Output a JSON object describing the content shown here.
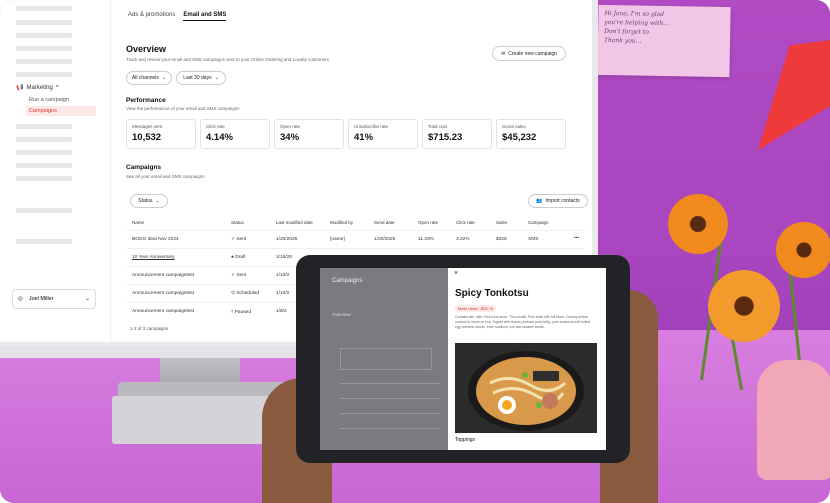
{
  "note_lines": [
    "Hi Jana, I'm so glad",
    "you're helping with...",
    "Don't forget to",
    "Thank you..."
  ],
  "sidebar": {
    "marketing": "Marketing",
    "run_campaign": "Run a campaign",
    "campaigns": "Campaigns",
    "user": "Joel Miller"
  },
  "tabs": [
    "Ads & promotions",
    "Email and SMS"
  ],
  "overview": {
    "title": "Overview",
    "subtitle": "Track and review your email and SMS campaigns sent to your Online Ordering and Loyalty customers",
    "create_button": "Create new campaign",
    "filter_channels": "All channels",
    "filter_days": "Last 30 days"
  },
  "performance": {
    "title": "Performance",
    "subtitle": "View the performance of your email and SMS campaigns",
    "cards": [
      {
        "label": "Messages sent",
        "value": "10,532"
      },
      {
        "label": "Click rate",
        "value": "4.14%"
      },
      {
        "label": "Open rate",
        "value": "34%"
      },
      {
        "label": "Unsubscribe rate",
        "value": "41%"
      },
      {
        "label": "Total cost",
        "value": "$715.23"
      },
      {
        "label": "Gross sales",
        "value": "$45,232"
      }
    ]
  },
  "campaigns": {
    "title": "Campaigns",
    "subtitle": "See all your email and SMS campaigns",
    "status_filter": "Status",
    "import_button": "Import contacts",
    "headers": [
      "Name",
      "Status",
      "Last modified date",
      "Modified by",
      "Send date",
      "Open rate",
      "Click rate",
      "Sales",
      "Campaign"
    ],
    "rows": [
      {
        "name": "BOGO deal Nov 2024",
        "status": "Sent",
        "modified": "1/20/2025",
        "by": "[name]",
        "send": "1/20/2025",
        "open": "11.33%",
        "click": "3.22%",
        "sales": "$326",
        "type": "SMS",
        "more": "•••"
      },
      {
        "name": "10 Year Anniversary",
        "status": "Draft",
        "modified": "1/16/20",
        "by": "",
        "send": "",
        "open": "",
        "click": "",
        "sales": "",
        "type": "",
        "more": ""
      },
      {
        "name": "Announcement campaigntest",
        "status": "Sent",
        "modified": "1/10/2",
        "by": "",
        "send": "",
        "open": "",
        "click": "",
        "sales": "",
        "type": "",
        "more": ""
      },
      {
        "name": "Announcement campaigntest",
        "status": "Scheduled",
        "modified": "1/10/2",
        "by": "",
        "send": "",
        "open": "",
        "click": "",
        "sales": "",
        "type": "",
        "more": ""
      },
      {
        "name": "Announcement campaigntest",
        "status": "Paused",
        "modified": "1/8/2",
        "by": "",
        "send": "",
        "open": "",
        "click": "",
        "sales": "",
        "type": "",
        "more": ""
      }
    ],
    "pager": "1-3 of 3 campaigns"
  },
  "tablet": {
    "close": "×",
    "title": "Spicy Tonkotsu",
    "badge": "Most Liked  ·  $28.75",
    "description": "Contains fish, milk. Pork bone stock. Thin noodle. Pork broth with full flavor. Creamy texture cooked for hours on end. Topped with chashu (braised pork belly), pork seasoned soft boiled egg, bamboo shoots, fresh scallions, nori and sesame seeds.",
    "toppings": "Toppings",
    "left_title": "Campaigns",
    "left_overview": "Overview"
  },
  "colors": {
    "wall": "#b04bc4",
    "accent": "#d33333",
    "lamp": "#ee3a3a",
    "flower": "#f08a1c"
  }
}
